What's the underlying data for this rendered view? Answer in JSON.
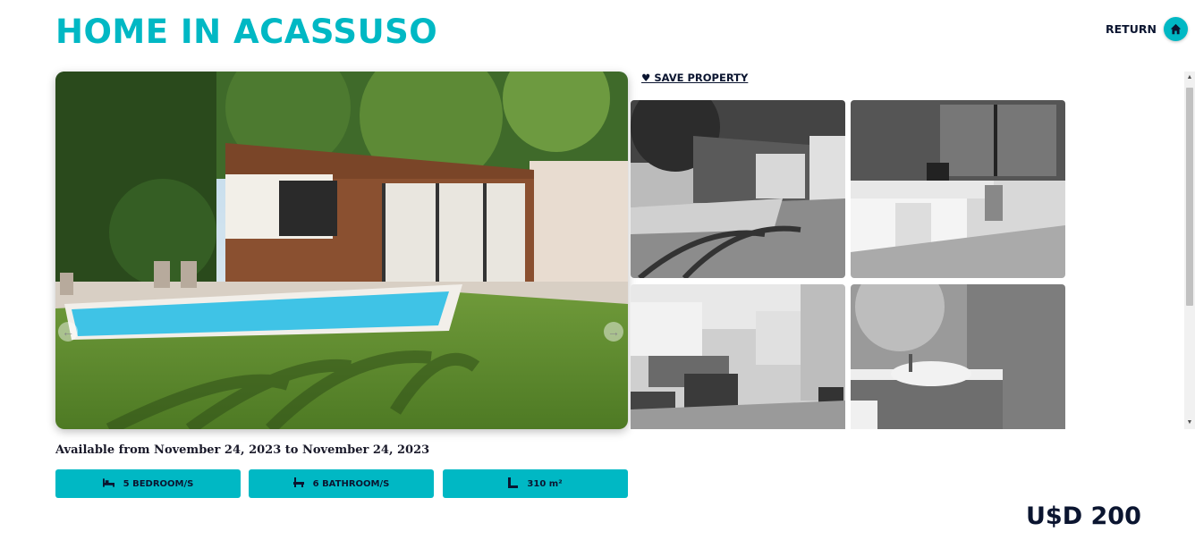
{
  "header": {
    "title": "HOME IN ACASSUSO",
    "return_label": "RETURN",
    "return_icon": "home-icon"
  },
  "gallery": {
    "save_label": "♥ SAVE PROPERTY",
    "prev_icon": "arrow-left-icon",
    "next_icon": "arrow-right-icon"
  },
  "details": {
    "availability": "Available from November 24, 2023 to November 24, 2023",
    "features": [
      {
        "icon": "bed-icon",
        "label": "5 BEDROOM/S"
      },
      {
        "icon": "bath-icon",
        "label": "6 BATHROOM/S"
      },
      {
        "icon": "area-icon",
        "label": "310 m²"
      }
    ],
    "price": "U$D 200"
  },
  "colors": {
    "accent": "#00b8c4",
    "text_dark": "#0b1530"
  }
}
